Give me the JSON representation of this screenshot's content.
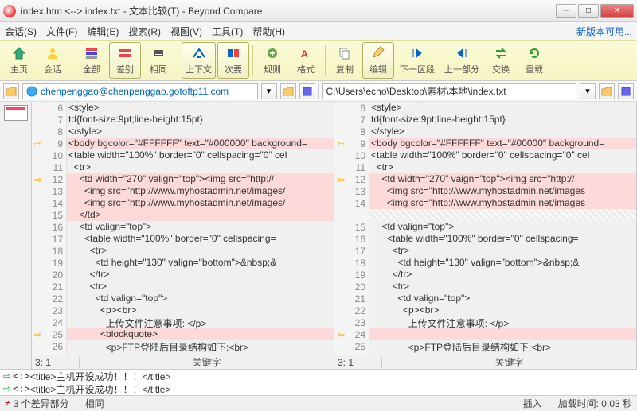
{
  "window": {
    "title": "index.htm <--> index.txt - 文本比较(T) - Beyond Compare"
  },
  "menu": {
    "session": "会话(S)",
    "file": "文件(F)",
    "edit": "编辑(E)",
    "search": "搜索(R)",
    "view": "视图(V)",
    "tools": "工具(T)",
    "help": "帮助(H)",
    "update": "新版本可用..."
  },
  "toolbar": {
    "home": "主页",
    "session": "会话",
    "all": "全部",
    "diff": "差别",
    "same": "相同",
    "context": "上下文",
    "minor": "次要",
    "rules": "规则",
    "format": "格式",
    "copy": "复制",
    "edit": "编辑",
    "nextsec": "下一区段",
    "prevsec": "上一部分",
    "swap": "交换",
    "reload": "重载"
  },
  "paths": {
    "left": "chenpenggao@chenpenggao.gotoftp11.com",
    "right": "C:\\Users\\echo\\Desktop\\素材\\本地\\index.txt"
  },
  "left": {
    "lines": [
      {
        "n": 6,
        "t": "<style>"
      },
      {
        "n": 7,
        "t": "td{font-size:9pt;line-height:15pt}"
      },
      {
        "n": 8,
        "t": "</style>"
      },
      {
        "n": 9,
        "t": "<body bgcolor=\"#FFFFFF\" text=\"#000000\" background=",
        "cls": "diff",
        "mark": "⇨"
      },
      {
        "n": 10,
        "t": "<table width=\"100%\" border=\"0\" cellspacing=\"0\" cel"
      },
      {
        "n": 11,
        "t": "  <tr>"
      },
      {
        "n": 12,
        "t": "    <td width=\"270\" valign=\"top\"><img src=\"http://",
        "cls": "diff",
        "mark": "⇨"
      },
      {
        "n": 13,
        "t": "      <img src=\"http://www.myhostadmin.net/images/",
        "cls": "diff"
      },
      {
        "n": 14,
        "t": "      <img src=\"http://www.myhostadmin.net/images/",
        "cls": "diff"
      },
      {
        "n": 15,
        "t": "    </td>",
        "cls": "diff"
      },
      {
        "n": 16,
        "t": "    <td valign=\"top\">"
      },
      {
        "n": 17,
        "t": "      <table width=\"100%\" border=\"0\" cellspacing="
      },
      {
        "n": 18,
        "t": "        <tr>"
      },
      {
        "n": 19,
        "t": "          <td height=\"130\" valign=\"bottom\">&nbsp;&"
      },
      {
        "n": 20,
        "t": "        </tr>"
      },
      {
        "n": 21,
        "t": "        <tr>"
      },
      {
        "n": 22,
        "t": "          <td valign=\"top\">"
      },
      {
        "n": 23,
        "t": "            <p><br>"
      },
      {
        "n": 24,
        "t": "              上传文件注意事项: </p>"
      },
      {
        "n": 25,
        "t": "            <blockquote>",
        "cls": "diff",
        "mark": "⇨"
      },
      {
        "n": 26,
        "t": "              <p>FTP登陆后目录结构如下:<br>"
      }
    ],
    "pos": "3: 1",
    "kw": "关键字"
  },
  "right": {
    "lines": [
      {
        "n": 6,
        "t": "<style>"
      },
      {
        "n": 7,
        "t": "td{font-size:9pt;line-height:15pt}"
      },
      {
        "n": 8,
        "t": "</style>"
      },
      {
        "n": 9,
        "t": "<body bgcolor=\"#FFFFFF\" text=\"#00000\" background=",
        "cls": "diff",
        "mark": "⇦"
      },
      {
        "n": 10,
        "t": "<table width=\"100%\" border=\"0\" cellspacing=\"0\" cel"
      },
      {
        "n": 11,
        "t": "  <tr>"
      },
      {
        "n": 12,
        "t": "    <td width=\"270\" vaign=\"top\"><img src=\"http://",
        "cls": "diff",
        "mark": "⇦"
      },
      {
        "n": 13,
        "t": "      <img src=\"http://www.myhostadmin.net/images",
        "cls": "diff"
      },
      {
        "n": 14,
        "t": "      <img src=\"http://www.myhostadmin.net/images",
        "cls": "diff"
      },
      {
        "n": "",
        "t": "",
        "cls": "hatch"
      },
      {
        "n": 15,
        "t": "    <td valign=\"top\">"
      },
      {
        "n": 16,
        "t": "      <table width=\"100%\" border=\"0\" cellspacing="
      },
      {
        "n": 17,
        "t": "        <tr>"
      },
      {
        "n": 18,
        "t": "          <td height=\"130\" valign=\"bottom\">&nbsp;&"
      },
      {
        "n": 19,
        "t": "        </tr>"
      },
      {
        "n": 20,
        "t": "        <tr>"
      },
      {
        "n": 21,
        "t": "          <td valign=\"top\">"
      },
      {
        "n": 22,
        "t": "            <p><br>"
      },
      {
        "n": 23,
        "t": "              上传文件注意事项: </p>"
      },
      {
        "n": 24,
        "t": "",
        "cls": "diff",
        "mark": "⇦"
      },
      {
        "n": 25,
        "t": "              <p>FTP登陆后目录结构如下:<br>"
      }
    ],
    "pos": "3: 1",
    "kw": "关键字"
  },
  "bottom": {
    "line1": "<title>主机开设成功！！！</title>",
    "line2": "<title>主机开设成功！！！</title>"
  },
  "status": {
    "diffs": "3 个差异部分",
    "same": "相同",
    "insert": "插入",
    "loadtime": "加载时间: 0.03 秒"
  }
}
